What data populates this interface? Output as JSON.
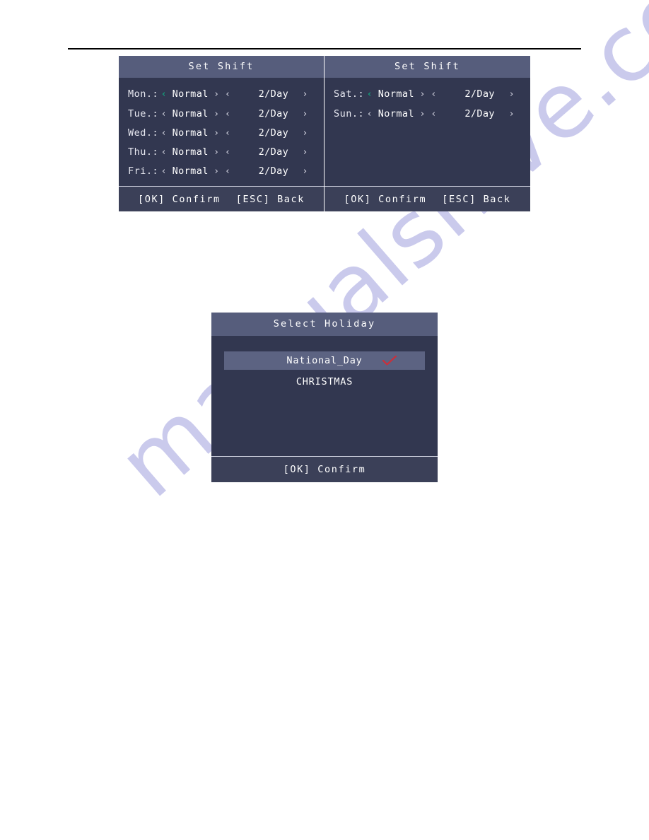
{
  "page": {
    "background": "#ffffff",
    "watermark": "manualshive.com",
    "watermark_color": "#b6b6e6",
    "rule_color": "#000000"
  },
  "theme": {
    "panel_bg": "#323750",
    "header_bg": "#565d7c",
    "footer_bg": "#3b4058",
    "text": "#ffffff",
    "accent_arrow": "#13a07c",
    "highlight_bg": "#5c6382",
    "check_color": "#cc2f3a",
    "divider": "#cfd2e0"
  },
  "panels": {
    "weekdays": {
      "title": "Set Shift",
      "rows": [
        {
          "day": "Mon.:",
          "left_arrow": "‹",
          "mode": "Normal",
          "right_arrow": "›",
          "count_left_arrow": "‹",
          "count": "2/Day",
          "count_right_arrow": "›",
          "accent": true
        },
        {
          "day": "Tue.:",
          "left_arrow": "‹",
          "mode": "Normal",
          "right_arrow": "›",
          "count_left_arrow": "‹",
          "count": "2/Day",
          "count_right_arrow": "›",
          "accent": false
        },
        {
          "day": "Wed.:",
          "left_arrow": "‹",
          "mode": "Normal",
          "right_arrow": "›",
          "count_left_arrow": "‹",
          "count": "2/Day",
          "count_right_arrow": "›",
          "accent": false
        },
        {
          "day": "Thu.:",
          "left_arrow": "‹",
          "mode": "Normal",
          "right_arrow": "›",
          "count_left_arrow": "‹",
          "count": "2/Day",
          "count_right_arrow": "›",
          "accent": false
        },
        {
          "day": "Fri.:",
          "left_arrow": "‹",
          "mode": "Normal",
          "right_arrow": "›",
          "count_left_arrow": "‹",
          "count": "2/Day",
          "count_right_arrow": "›",
          "accent": false
        }
      ],
      "footer": {
        "confirm": "[OK] Confirm",
        "back": "[ESC] Back"
      }
    },
    "weekend": {
      "title": "Set Shift",
      "rows": [
        {
          "day": "Sat.:",
          "left_arrow": "‹",
          "mode": "Normal",
          "right_arrow": "›",
          "count_left_arrow": "‹",
          "count": "2/Day",
          "count_right_arrow": "›",
          "accent": true
        },
        {
          "day": "Sun.:",
          "left_arrow": "‹",
          "mode": "Normal",
          "right_arrow": "›",
          "count_left_arrow": "‹",
          "count": "2/Day",
          "count_right_arrow": "›",
          "accent": false
        }
      ],
      "footer": {
        "confirm": "[OK] Confirm",
        "back": "[ESC] Back"
      }
    },
    "holiday": {
      "title": "Select Holiday",
      "items": [
        {
          "label": "National_Day",
          "selected": true,
          "checked": true
        },
        {
          "label": "CHRISTMAS",
          "selected": false,
          "checked": false
        }
      ],
      "footer": {
        "confirm": "[OK] Confirm"
      }
    }
  }
}
